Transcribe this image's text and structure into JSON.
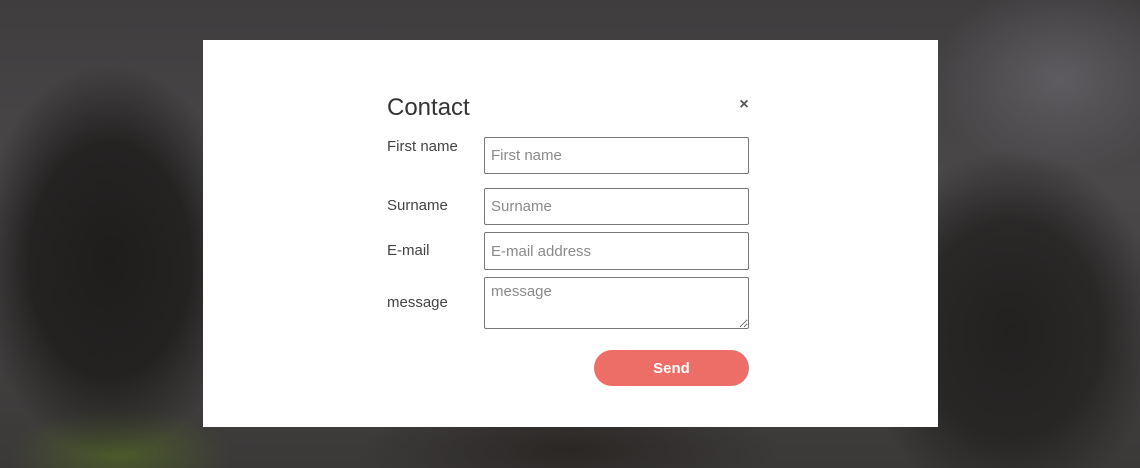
{
  "dialog": {
    "title": "Contact",
    "close_icon": "close-icon",
    "close_glyph": "×"
  },
  "form": {
    "first_name": {
      "label": "First name",
      "placeholder": "First name",
      "value": ""
    },
    "surname": {
      "label": "Surname",
      "placeholder": "Surname",
      "value": ""
    },
    "email": {
      "label": "E-mail",
      "placeholder": "E-mail address",
      "value": ""
    },
    "message": {
      "label": "message",
      "placeholder": "message",
      "value": ""
    },
    "send_label": "Send"
  },
  "colors": {
    "send_button": "#ec6e66",
    "modal_background": "#ffffff"
  }
}
